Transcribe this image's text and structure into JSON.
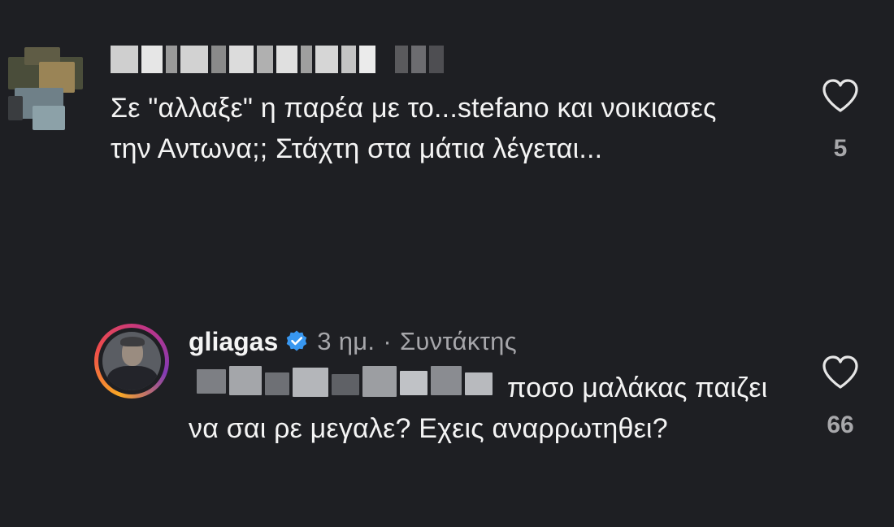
{
  "comments": [
    {
      "username_redacted": true,
      "text": "Σε \"αλλαξε\" η παρέα με το...stefano και νοικιασες την Αντωνα;; Στάχτη στα μάτια λέγεται...",
      "likes": "5"
    },
    {
      "username": "gliagas",
      "verified": true,
      "time": "3 ημ.",
      "separator": "·",
      "role": "Συντάκτης",
      "mention_redacted": true,
      "text": "ποσο μαλάκας παιζει να σαι ρε μεγαλε? Εχεις αναρρωτηθει?",
      "likes": "66"
    }
  ],
  "icons": {
    "like": "heart-outline-icon",
    "verified": "verified-badge-icon"
  },
  "colors": {
    "background": "#1e1f23",
    "text_primary": "#f4f4f4",
    "text_secondary": "#a6a6aa",
    "verified_blue": "#3897f0"
  }
}
